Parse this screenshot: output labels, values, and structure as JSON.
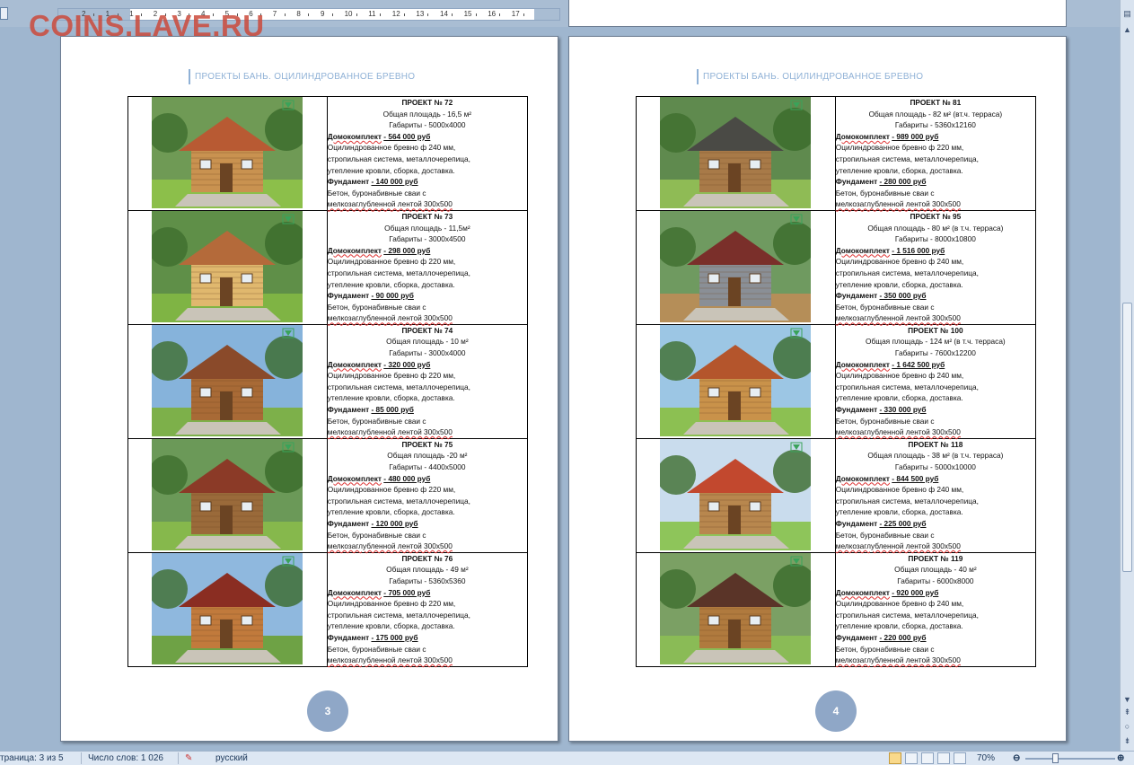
{
  "watermark": "COINS.LAVE.RU",
  "ruler": {
    "labels": [
      "2",
      "1",
      "1",
      "2",
      "3",
      "4",
      "5",
      "6",
      "7",
      "8",
      "9",
      "10",
      "11",
      "12",
      "13",
      "14",
      "15",
      "16",
      "17"
    ]
  },
  "header_text": "ПРОЕКТЫ БАНЬ. ОЦИЛИНДРОВАННОЕ БРЕВНО",
  "pages": [
    {
      "number": "3",
      "projects": [
        {
          "title": "ПРОЕКТ № 72",
          "area": "Общая площадь - 16,5 м²",
          "size": "Габариты  - 5000х4000",
          "kit_label": "Домокомплект",
          "kit_price": "- 564 000 руб",
          "kit_desc_1": "Оцилиндрованное  бревно ф 240 мм,",
          "kit_desc_2": "стропильная система, металлочерепица,",
          "kit_desc_3": "утепление кровли, сборка, доставка.",
          "found_label": "Фундамент",
          "found_price": "- 140 000 руб",
          "found_desc_1": " Бетон, буронабивные сваи с",
          "found_desc_2": "мелкозаглубленной  лентой 300х500"
        },
        {
          "title": "ПРОЕКТ № 73",
          "area": "Общая площадь - 11,5м²",
          "size": "Габариты  - 3000х4500",
          "kit_label": "Домокомплект",
          "kit_price": "- 298 000 руб",
          "kit_desc_1": "Оцилиндрованное  бревно ф 220 мм,",
          "kit_desc_2": "стропильная система, металлочерепица,",
          "kit_desc_3": "утепление кровли, сборка, доставка.",
          "found_label": "Фундамент",
          "found_price": "- 90 000 руб",
          "found_desc_1": " Бетон, буронабивные сваи с",
          "found_desc_2": "мелкозаглубленной  лентой 300х500"
        },
        {
          "title": "ПРОЕКТ № 74",
          "area": "Общая площадь - 10 м²",
          "size": "Габариты  - 3000х4000",
          "kit_label": "Домокомплект",
          "kit_price": "- 320 000 руб",
          "kit_desc_1": "Оцилиндрованное  бревно ф 220 мм,",
          "kit_desc_2": "стропильная система, металлочерепица,",
          "kit_desc_3": "утепление кровли, сборка, доставка.",
          "found_label": "Фундамент",
          "found_price": "- 85 000 руб",
          "found_desc_1": " Бетон, буронабивные сваи с",
          "found_desc_2": "мелкозаглубленной  лентой 300х500"
        },
        {
          "title": "ПРОЕКТ № 75",
          "area": "Общая площадь -20 м²",
          "size": "Габариты  - 4400х5000",
          "kit_label": "Домокомплект",
          "kit_price": "- 480 000 руб",
          "kit_desc_1": "Оцилиндрованное  бревно ф 220 мм,",
          "kit_desc_2": "стропильная система, металлочерепица,",
          "kit_desc_3": "утепление кровли, сборка, доставка.",
          "found_label": "Фундамент",
          "found_price": "- 120 000 руб",
          "found_desc_1": " Бетон, буронабивные сваи с",
          "found_desc_2": "мелкозаглубленной  лентой 300х500"
        },
        {
          "title": "ПРОЕКТ № 76",
          "area": "Общая площадь - 49 м²",
          "size": "Габариты  - 5360х5360",
          "kit_label": "Домокомплект",
          "kit_price": "- 705 000 руб",
          "kit_desc_1": "Оцилиндрованное  бревно ф 220 мм,",
          "kit_desc_2": "стропильная система, металлочерепица,",
          "kit_desc_3": "утепление кровли, сборка, доставка.",
          "found_label": "Фундамент",
          "found_price": "- 175 000 руб",
          "found_desc_1": " Бетон, буронабивные сваи с",
          "found_desc_2": "мелкозаглубленной  лентой 300х500"
        }
      ]
    },
    {
      "number": "4",
      "projects": [
        {
          "title": "ПРОЕКТ № 81",
          "area": "Общая площадь - 82 м² (вт.ч. терраса)",
          "size": "Габариты  - 5360х12160",
          "kit_label": "Домокомплект",
          "kit_price": "- 989 000 руб",
          "kit_desc_1": "Оцилиндрованное  бревно ф 220 мм,",
          "kit_desc_2": "стропильная система, металлочерепица,",
          "kit_desc_3": "утепление кровли, сборка, доставка.",
          "found_label": "Фундамент",
          "found_price": "- 280 000 руб",
          "found_desc_1": " Бетон, буронабивные сваи с",
          "found_desc_2": "мелкозаглубленной  лентой 300х500"
        },
        {
          "title": "ПРОЕКТ № 95",
          "area": "Общая площадь - 80 м² (в т.ч. терраса)",
          "size": "Габариты  - 8000х10800",
          "kit_label": "Домокомплект",
          "kit_price": "- 1 516 000 руб",
          "kit_desc_1": "Оцилиндрованное  бревно ф 240 мм,",
          "kit_desc_2": "стропильная система, металлочерепица,",
          "kit_desc_3": "утепление кровли, сборка, доставка.",
          "found_label": "Фундамент",
          "found_price": "- 350 000 руб",
          "found_desc_1": " Бетон, буронабивные сваи с",
          "found_desc_2": "мелкозаглубленной  лентой 300х500"
        },
        {
          "title": "ПРОЕКТ № 100",
          "area": "Общая площадь - 124 м² (в т.ч. терраса)",
          "size": "Габариты  - 7600х12200",
          "kit_label": "Домокомплект",
          "kit_price": "- 1 642 500 руб",
          "kit_desc_1": "Оцилиндрованное  бревно ф 240 мм,",
          "kit_desc_2": "стропильная система, металлочерепица,",
          "kit_desc_3": "утепление кровли, сборка, доставка.",
          "found_label": "Фундамент",
          "found_price": "- 330 000 руб",
          "found_desc_1": " Бетон, буронабивные сваи с",
          "found_desc_2": "мелкозаглубленной  лентой 300х500"
        },
        {
          "title": "ПРОЕКТ № 118",
          "area": "Общая площадь - 38 м² (в т.ч. терраса)",
          "size": "Габариты  - 5000х10000",
          "kit_label": "Домокомплект",
          "kit_price": "- 844 500 руб",
          "kit_desc_1": "Оцилиндрованное  бревно ф 240 мм,",
          "kit_desc_2": "стропильная система, металлочерепица,",
          "kit_desc_3": "утепление кровли, сборка, доставка.",
          "found_label": "Фундамент",
          "found_price": "- 225 000 руб",
          "found_desc_1": " Бетон, буронабивные сваи с",
          "found_desc_2": "мелкозаглубленной  лентой 300х500"
        },
        {
          "title": "ПРОЕКТ № 119",
          "area": "Общая площадь - 40 м²",
          "size": "Габариты  - 6000х8000",
          "kit_label": "Домокомплект",
          "kit_price": "- 920 000 руб",
          "kit_desc_1": "Оцилиндрованное  бревно ф 240 мм,",
          "kit_desc_2": "стропильная система, металлочерепица,",
          "kit_desc_3": "утепление кровли, сборка, доставка.",
          "found_label": "Фундамент",
          "found_price": "- 220 000 руб",
          "found_desc_1": " Бетон, буронабивные сваи с",
          "found_desc_2": "мелкозаглубленной  лентой 300х500"
        }
      ]
    }
  ],
  "status_bar": {
    "page": "траница: 3 из 5",
    "words": "Число слов: 1 026",
    "language": "русский",
    "zoom": "70%"
  },
  "colors": {
    "accent": "#8fa7c7",
    "header": "#8fb1d6",
    "watermark": "#cc4b3c"
  }
}
